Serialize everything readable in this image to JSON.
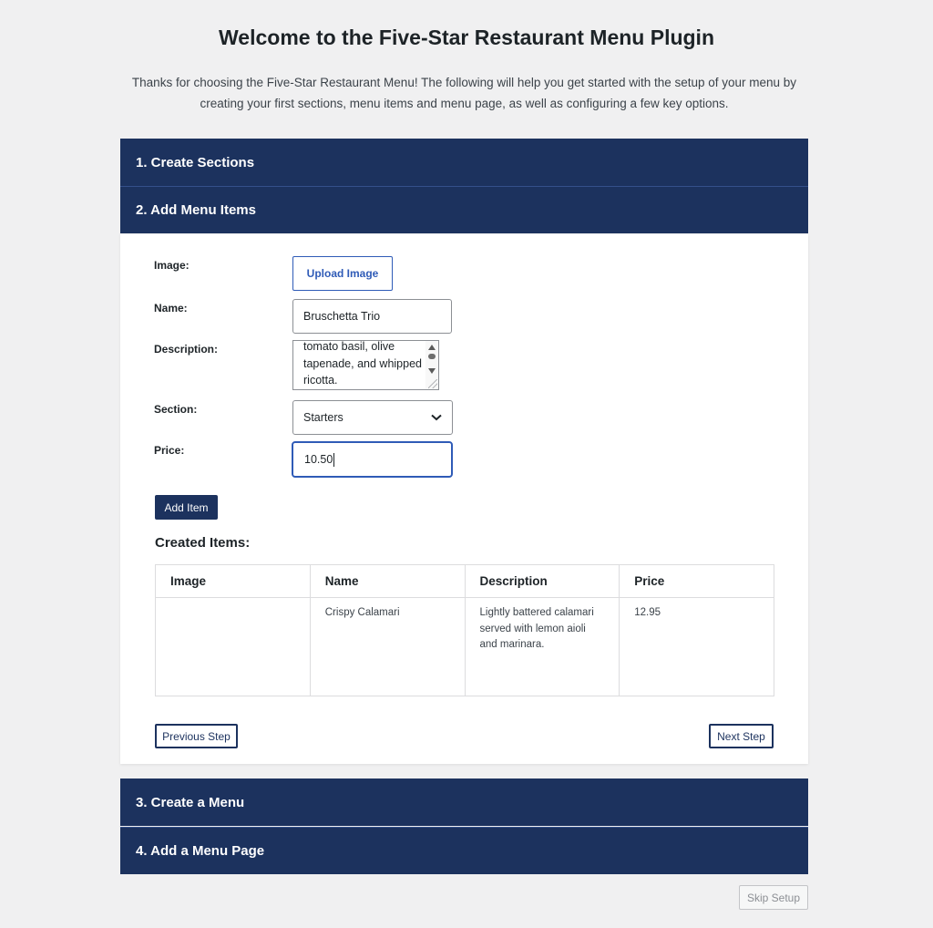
{
  "page": {
    "title": "Welcome to the Five-Star Restaurant Menu Plugin",
    "intro": "Thanks for choosing the Five-Star Restaurant Menu! The following will help you get started with the setup of your menu by creating your first sections, menu items and menu page, as well as configuring a few key options."
  },
  "steps": [
    {
      "label": "1. Create Sections"
    },
    {
      "label": "2. Add Menu Items"
    },
    {
      "label": "3. Create a Menu"
    },
    {
      "label": "4. Add a Menu Page"
    }
  ],
  "form": {
    "image_label": "Image:",
    "upload_label": "Upload Image",
    "name_label": "Name:",
    "name_value": "Bruschetta Trio",
    "description_label": "Description:",
    "description_visible": "tomato basil, olive tapenade, and whipped ricotta.",
    "section_label": "Section:",
    "section_value": "Starters",
    "price_label": "Price:",
    "price_value": "10.50",
    "add_label": "Add Item"
  },
  "created": {
    "title": "Created Items:",
    "columns": [
      "Image",
      "Name",
      "Description",
      "Price"
    ],
    "rows": [
      {
        "image": "",
        "name": "Crispy Calamari",
        "description": "Lightly battered calamari served with lemon aioli and marinara.",
        "price": "12.95"
      }
    ]
  },
  "nav": {
    "previous_label": "Previous Step",
    "next_label": "Next Step",
    "skip_label": "Skip Setup"
  },
  "colors": {
    "header_navy": "#1c325e",
    "accent_blue": "#2f5bb7",
    "background": "#f0f0f1"
  }
}
